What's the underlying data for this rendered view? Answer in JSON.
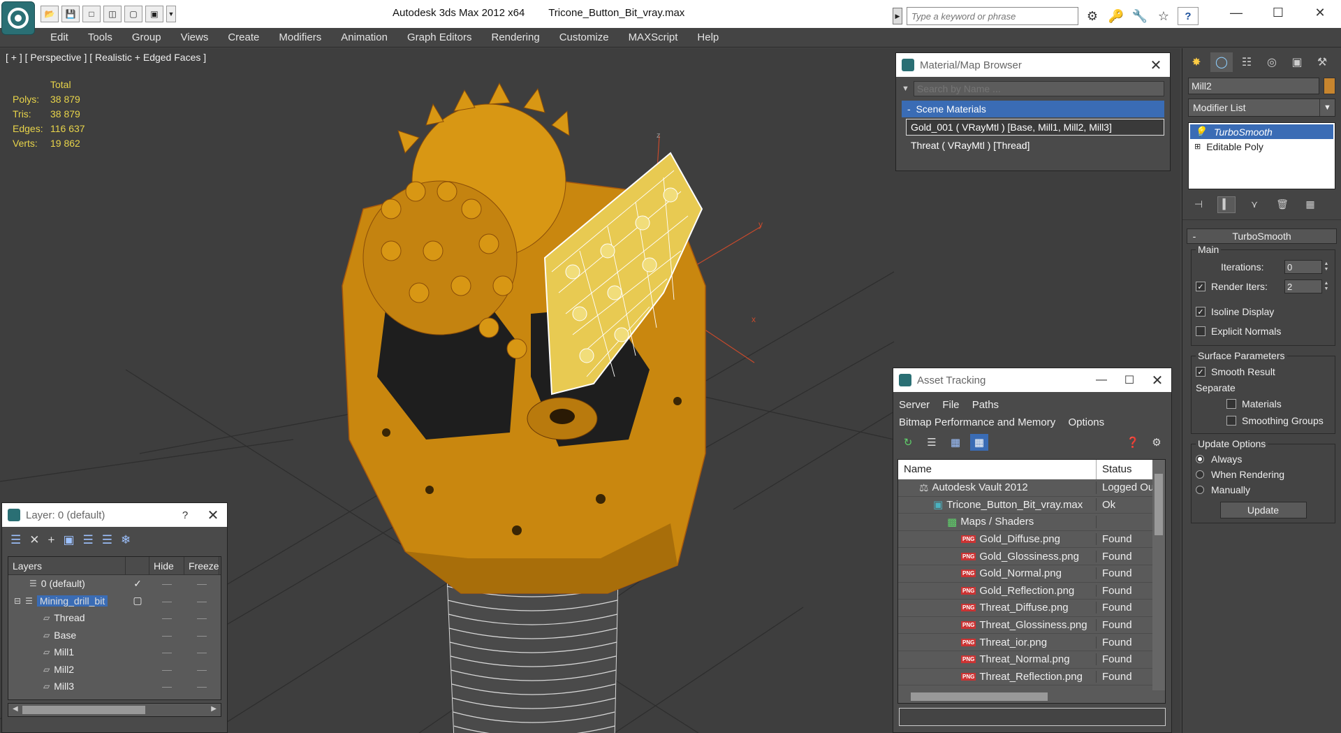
{
  "window": {
    "app_title": "Autodesk 3ds Max  2012 x64",
    "file_name": "Tricone_Button_Bit_vray.max",
    "search_placeholder": "Type a keyword or phrase",
    "help": "?"
  },
  "menu": [
    "Edit",
    "Tools",
    "Group",
    "Views",
    "Create",
    "Modifiers",
    "Animation",
    "Graph Editors",
    "Rendering",
    "Customize",
    "MAXScript",
    "Help"
  ],
  "viewport": {
    "label": "[ + ] [ Perspective ] [ Realistic + Edged Faces ]",
    "stats": {
      "header": "Total",
      "rows": [
        {
          "k": "Polys:",
          "v": "38 879"
        },
        {
          "k": "Tris:",
          "v": "38 879"
        },
        {
          "k": "Edges:",
          "v": "116 637"
        },
        {
          "k": "Verts:",
          "v": "19 862"
        }
      ]
    },
    "axes": {
      "y": "y",
      "x": "x",
      "z": "z"
    },
    "model_color": "#c9870f",
    "wire_color": "#ffffff"
  },
  "material_browser": {
    "title": "Material/Map Browser",
    "search_placeholder": "Search by Name ...",
    "section": "Scene Materials",
    "section_marker": "-",
    "items": [
      "Gold_001  ( VRayMtl )  [Base, Mill1, Mill2, Mill3]",
      "Threat  ( VRayMtl )  [Thread]"
    ]
  },
  "layer_panel": {
    "title": "Layer: 0 (default)",
    "help": "?",
    "columns": {
      "layers": "Layers",
      "hide": "Hide",
      "freeze": "Freeze"
    },
    "rows": [
      {
        "name": "0 (default)",
        "level": 0,
        "checked": true,
        "selected": false
      },
      {
        "name": "Mining_drill_bit",
        "level": 0,
        "checked": false,
        "selected": true
      },
      {
        "name": "Thread",
        "level": 1,
        "checked": false,
        "selected": false
      },
      {
        "name": "Base",
        "level": 1,
        "checked": false,
        "selected": false
      },
      {
        "name": "Mill1",
        "level": 1,
        "checked": false,
        "selected": false
      },
      {
        "name": "Mill2",
        "level": 1,
        "checked": false,
        "selected": false
      },
      {
        "name": "Mill3",
        "level": 1,
        "checked": false,
        "selected": false
      }
    ]
  },
  "asset_tracking": {
    "title": "Asset Tracking",
    "menu1": [
      "Server",
      "File",
      "Paths"
    ],
    "menu2": [
      "Bitmap Performance and Memory",
      "Options"
    ],
    "columns": {
      "name": "Name",
      "status": "Status"
    },
    "rows": [
      {
        "name": "Autodesk Vault 2012",
        "status": "Logged Ou",
        "indent": 1,
        "icon": "vault"
      },
      {
        "name": "Tricone_Button_Bit_vray.max",
        "status": "Ok",
        "indent": 2,
        "icon": "max"
      },
      {
        "name": "Maps / Shaders",
        "status": "",
        "indent": 3,
        "icon": "maps"
      },
      {
        "name": "Gold_Diffuse.png",
        "status": "Found",
        "indent": 4,
        "icon": "png"
      },
      {
        "name": "Gold_Glossiness.png",
        "status": "Found",
        "indent": 4,
        "icon": "png"
      },
      {
        "name": "Gold_Normal.png",
        "status": "Found",
        "indent": 4,
        "icon": "png"
      },
      {
        "name": "Gold_Reflection.png",
        "status": "Found",
        "indent": 4,
        "icon": "png"
      },
      {
        "name": "Threat_Diffuse.png",
        "status": "Found",
        "indent": 4,
        "icon": "png"
      },
      {
        "name": "Threat_Glossiness.png",
        "status": "Found",
        "indent": 4,
        "icon": "png"
      },
      {
        "name": "Threat_ior.png",
        "status": "Found",
        "indent": 4,
        "icon": "png"
      },
      {
        "name": "Threat_Normal.png",
        "status": "Found",
        "indent": 4,
        "icon": "png"
      },
      {
        "name": "Threat_Reflection.png",
        "status": "Found",
        "indent": 4,
        "icon": "png"
      }
    ],
    "png_badge": "PNG"
  },
  "command_panel": {
    "object_name": "Mill2",
    "object_color": "#c7852e",
    "modifier_list": "Modifier List",
    "stack": [
      "TurboSmooth",
      "Editable Poly"
    ],
    "rollout_title": "TurboSmooth",
    "rollout_marker": "-",
    "main": {
      "label": "Main",
      "iterations_label": "Iterations:",
      "iterations": "0",
      "render_iters_label": "Render Iters:",
      "render_iters": "2",
      "isoline": "Isoline Display",
      "explicit_normals": "Explicit Normals"
    },
    "surface": {
      "label": "Surface Parameters",
      "smooth_result": "Smooth Result",
      "separate": "Separate",
      "materials": "Materials",
      "smoothing_groups": "Smoothing Groups"
    },
    "update": {
      "label": "Update Options",
      "always": "Always",
      "when_rendering": "When Rendering",
      "manually": "Manually",
      "button": "Update"
    }
  }
}
